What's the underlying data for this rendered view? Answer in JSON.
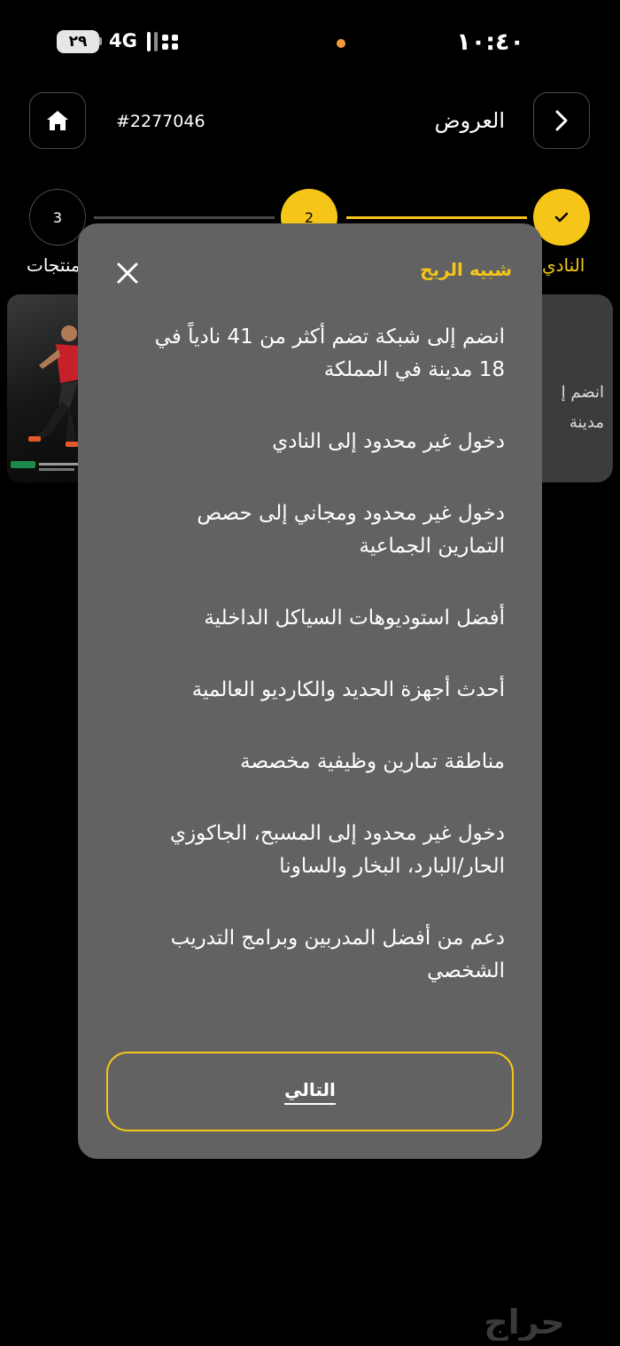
{
  "status_bar": {
    "time": "١٠:٤٠",
    "battery": "٢٩",
    "network": "4G"
  },
  "header": {
    "title": "العروض",
    "ad_id": "#2277046",
    "home_icon": "home-icon",
    "back_icon": "chevron-right-icon"
  },
  "stepper": {
    "steps": [
      {
        "number": "✓",
        "label": "النادي",
        "state": "completed"
      },
      {
        "number": "2",
        "label": "",
        "state": "current"
      },
      {
        "number": "3",
        "label": "منتجات",
        "state": "upcoming"
      }
    ]
  },
  "background_card": {
    "line1": "انضم إ",
    "line2": "مدينة"
  },
  "modal": {
    "title": "شبيه الريح",
    "close_icon": "close-icon",
    "features": [
      "انضم إلى شبكة تضم أكثر من 41 نادياً في 18 مدينة في المملكة",
      "دخول غير محدود إلى النادي",
      "دخول غير محدود ومجاني إلى حصص التمارين الجماعية",
      "أفضل استوديوهات السياكل الداخلية",
      "أحدث أجهزة الحديد والكارديو العالمية",
      "مناطقة تمارين وظيفية مخصصة",
      "دخول غير محدود إلى المسبح، الجاكوزي الحار/البارد، البخار والساونا",
      "دعم من أفضل المدربين وبرامج التدريب الشخصي"
    ],
    "next_label": "التالي"
  },
  "colors": {
    "accent": "#f5c518",
    "modal_bg": "#626262",
    "background": "#000000"
  }
}
